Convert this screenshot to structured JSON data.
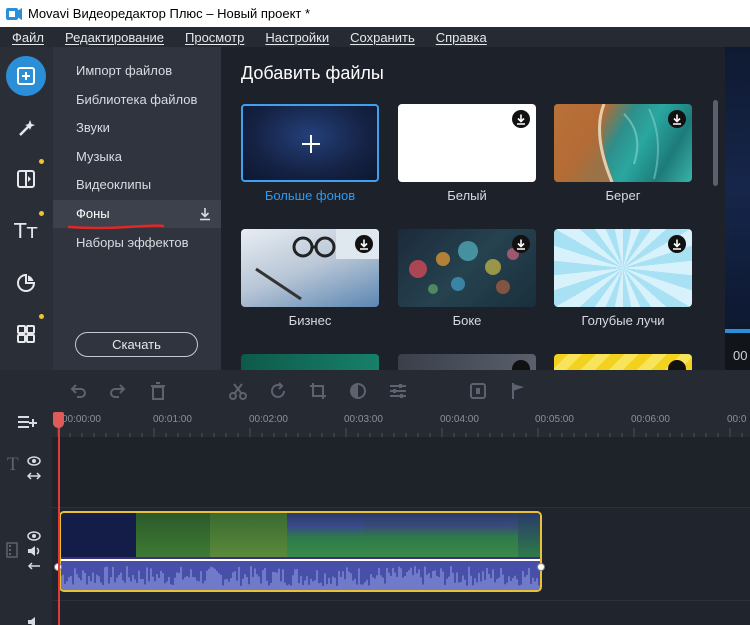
{
  "window": {
    "title": "Movavi Видеоредактор Плюс – Новый проект *"
  },
  "menu": [
    "Файл",
    "Редактирование",
    "Просмотр",
    "Настройки",
    "Сохранить",
    "Справка"
  ],
  "rail": {
    "items": [
      {
        "icon": "import-icon",
        "active": true
      },
      {
        "icon": "magic-wand-icon",
        "active": false
      },
      {
        "icon": "transitions-icon",
        "active": false
      },
      {
        "icon": "titles-icon",
        "active": false
      },
      {
        "icon": "stickers-icon",
        "active": false
      },
      {
        "icon": "more-tools-icon",
        "active": false
      }
    ],
    "titles_glyph": "Tт"
  },
  "categories": {
    "items": [
      "Импорт файлов",
      "Библиотека файлов",
      "Звуки",
      "Музыка",
      "Видеоклипы",
      "Фоны",
      "Наборы эффектов"
    ],
    "selected": "Фоны",
    "download_label": "Скачать"
  },
  "content": {
    "title": "Добавить файлы",
    "tiles": [
      {
        "label": "Больше фонов",
        "download": false,
        "accent": true
      },
      {
        "label": "Белый",
        "download": true
      },
      {
        "label": "Берег",
        "download": true
      },
      {
        "label": "Бизнес",
        "download": true
      },
      {
        "label": "Боке",
        "download": true
      },
      {
        "label": "Голубые лучи",
        "download": true
      }
    ]
  },
  "preview": {
    "time": "00"
  },
  "timeline": {
    "ticks": [
      "00:00:00",
      "00:01:00",
      "00:02:00",
      "00:03:00",
      "00:04:00",
      "00:05:00",
      "00:06:00",
      "00:0"
    ]
  },
  "colors": {
    "accent": "#2b8fd8",
    "clip_border": "#e8c234",
    "playhead": "#e03a3a",
    "audio": "#4650a8"
  }
}
